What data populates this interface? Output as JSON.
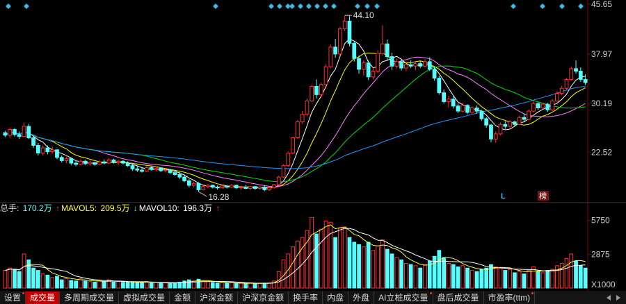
{
  "price_axis": {
    "labels": [
      "45.65",
      "37.97",
      "30.19",
      "22.52"
    ],
    "max": 45.65,
    "min": 15.0
  },
  "annotations": {
    "high": "44.10",
    "low": "16.28",
    "marker_l": "L",
    "marker_bang": "榜"
  },
  "volume_legend": {
    "total_label": "总手:",
    "total_value": "170.2万",
    "mavol5_label": "MAVOL5:",
    "mavol5_value": "209.5万",
    "mavol10_label": "MAVOL10:",
    "mavol10_value": "196.3万",
    "mavol5_arrow": "↑",
    "mavol10_arrow": "↓",
    "total_arrow": "↑"
  },
  "volume_axis": {
    "labels": [
      "5750",
      "2875"
    ],
    "unit": "X1000",
    "max": 6200
  },
  "tabs": [
    {
      "label": "设置",
      "dot": true
    },
    {
      "label": "成交量",
      "active": true
    },
    {
      "label": "多周期成交量"
    },
    {
      "label": "虚拟成交量"
    },
    {
      "label": "金额"
    },
    {
      "label": "沪深金额"
    },
    {
      "label": "沪深京金额"
    },
    {
      "label": "换手率"
    },
    {
      "label": "内盘"
    },
    {
      "label": "外盘"
    },
    {
      "label": "AI立桩成交量",
      "dot": true
    },
    {
      "label": "盘后成交量"
    },
    {
      "label": "市盈率(ttm)",
      "dot": true
    }
  ],
  "colors": {
    "up": "#ff3232",
    "down": "#54ffff",
    "ma1": "#ffffff",
    "ma2": "#ffff00",
    "ma3": "#ff80ff",
    "ma4": "#00e000",
    "ma5": "#1e9aff",
    "grid": "#800000"
  },
  "chart_data": {
    "type": "candlestick",
    "candles": [
      [
        25.6,
        25.9,
        24.9,
        25.2
      ],
      [
        25.2,
        26.4,
        24.8,
        26.1
      ],
      [
        26.1,
        26.3,
        25.0,
        25.3
      ],
      [
        25.3,
        25.8,
        24.6,
        25.0
      ],
      [
        25.0,
        27.2,
        24.9,
        26.6
      ],
      [
        26.6,
        27.0,
        24.6,
        24.8
      ],
      [
        24.8,
        25.0,
        23.2,
        23.6
      ],
      [
        23.6,
        24.0,
        22.0,
        22.4
      ],
      [
        22.4,
        23.6,
        22.0,
        23.2
      ],
      [
        23.2,
        23.6,
        22.2,
        22.6
      ],
      [
        22.6,
        23.4,
        22.3,
        22.9
      ],
      [
        22.9,
        23.0,
        21.4,
        21.7
      ],
      [
        21.7,
        22.0,
        20.9,
        21.2
      ],
      [
        21.2,
        21.8,
        20.8,
        21.5
      ],
      [
        21.5,
        21.6,
        20.5,
        20.8
      ],
      [
        20.8,
        21.2,
        20.3,
        20.6
      ],
      [
        20.6,
        21.4,
        20.4,
        21.1
      ],
      [
        21.1,
        21.3,
        20.5,
        20.7
      ],
      [
        20.7,
        21.2,
        20.4,
        20.9
      ],
      [
        20.9,
        21.0,
        20.4,
        20.6
      ],
      [
        20.6,
        21.3,
        20.5,
        21.0
      ],
      [
        21.0,
        21.4,
        20.6,
        20.8
      ],
      [
        20.8,
        21.6,
        20.7,
        21.3
      ],
      [
        21.3,
        21.5,
        20.7,
        20.9
      ],
      [
        20.9,
        21.3,
        20.5,
        21.1
      ],
      [
        21.1,
        21.3,
        20.6,
        20.8
      ],
      [
        20.8,
        21.1,
        20.2,
        20.4
      ],
      [
        20.4,
        20.6,
        19.6,
        19.9
      ],
      [
        19.9,
        20.4,
        19.4,
        19.7
      ],
      [
        19.7,
        20.2,
        19.3,
        19.5
      ],
      [
        19.5,
        20.4,
        19.4,
        20.1
      ],
      [
        20.1,
        20.3,
        19.6,
        19.8
      ],
      [
        19.8,
        20.3,
        19.5,
        20.0
      ],
      [
        20.0,
        20.1,
        19.4,
        19.6
      ],
      [
        19.6,
        20.0,
        19.3,
        19.7
      ],
      [
        19.7,
        19.9,
        19.1,
        19.3
      ],
      [
        19.3,
        19.6,
        18.8,
        19.0
      ],
      [
        19.0,
        19.4,
        18.3,
        18.6
      ],
      [
        18.6,
        18.9,
        17.8,
        18.0
      ],
      [
        18.0,
        18.3,
        17.0,
        17.3
      ],
      [
        17.3,
        17.9,
        17.0,
        17.6
      ],
      [
        17.6,
        17.8,
        16.3,
        16.6
      ],
      [
        16.6,
        17.3,
        16.5,
        17.1
      ],
      [
        17.1,
        17.5,
        16.8,
        17.3
      ],
      [
        17.3,
        17.4,
        16.8,
        17.0
      ],
      [
        17.0,
        17.3,
        16.6,
        16.9
      ],
      [
        16.9,
        17.4,
        16.8,
        17.2
      ],
      [
        17.2,
        17.3,
        16.8,
        17.0
      ],
      [
        17.0,
        17.5,
        16.9,
        17.3
      ],
      [
        17.3,
        17.4,
        16.7,
        16.9
      ],
      [
        16.9,
        17.2,
        16.6,
        17.0
      ],
      [
        17.0,
        17.3,
        16.7,
        16.8
      ],
      [
        16.8,
        17.2,
        16.6,
        17.1
      ],
      [
        17.1,
        17.2,
        16.6,
        16.8
      ],
      [
        16.8,
        17.2,
        16.6,
        17.0
      ],
      [
        17.0,
        17.2,
        16.4,
        16.6
      ],
      [
        16.6,
        17.0,
        16.4,
        16.9
      ],
      [
        16.9,
        17.5,
        16.8,
        17.4
      ],
      [
        17.4,
        18.8,
        17.3,
        18.6
      ],
      [
        18.6,
        20.6,
        18.5,
        20.4
      ],
      [
        20.4,
        22.6,
        20.2,
        22.4
      ],
      [
        22.4,
        25.0,
        22.2,
        24.8
      ],
      [
        24.8,
        27.6,
        24.6,
        27.3
      ],
      [
        27.3,
        29.0,
        27.0,
        28.5
      ],
      [
        28.5,
        31.0,
        28.2,
        30.6
      ],
      [
        30.6,
        33.2,
        30.4,
        32.9
      ],
      [
        32.9,
        34.0,
        31.0,
        31.6
      ],
      [
        31.6,
        33.5,
        31.3,
        33.2
      ],
      [
        33.2,
        36.4,
        33.0,
        36.0
      ],
      [
        36.0,
        39.5,
        35.8,
        39.1
      ],
      [
        39.1,
        40.4,
        37.4,
        38.0
      ],
      [
        38.0,
        42.3,
        37.8,
        42.0
      ],
      [
        42.0,
        44.1,
        41.6,
        43.2
      ],
      [
        43.2,
        44.0,
        39.2,
        39.7
      ],
      [
        39.7,
        40.0,
        36.8,
        37.3
      ],
      [
        37.3,
        37.8,
        34.9,
        35.6
      ],
      [
        35.6,
        37.0,
        34.6,
        36.6
      ],
      [
        36.6,
        37.0,
        33.9,
        34.4
      ],
      [
        34.4,
        35.8,
        34.0,
        35.3
      ],
      [
        35.3,
        38.6,
        35.0,
        38.1
      ],
      [
        38.1,
        42.5,
        37.8,
        39.6
      ],
      [
        39.6,
        40.3,
        37.1,
        37.6
      ],
      [
        37.6,
        38.2,
        35.5,
        36.1
      ],
      [
        36.1,
        37.3,
        35.7,
        36.8
      ],
      [
        36.8,
        37.1,
        35.4,
        35.8
      ],
      [
        35.8,
        36.7,
        35.3,
        36.3
      ],
      [
        36.3,
        37.0,
        35.8,
        36.1
      ],
      [
        36.1,
        36.9,
        35.5,
        36.5
      ],
      [
        36.5,
        37.0,
        35.8,
        36.1
      ],
      [
        36.1,
        37.2,
        35.9,
        36.8
      ],
      [
        36.8,
        37.5,
        35.3,
        35.6
      ],
      [
        35.6,
        36.0,
        33.8,
        34.2
      ],
      [
        34.2,
        34.6,
        31.6,
        31.9
      ],
      [
        31.9,
        32.4,
        30.2,
        30.5
      ],
      [
        30.5,
        31.4,
        29.6,
        30.9
      ],
      [
        30.9,
        31.3,
        29.4,
        29.8
      ],
      [
        29.8,
        30.2,
        28.7,
        29.0
      ],
      [
        29.0,
        30.3,
        28.8,
        29.9
      ],
      [
        29.9,
        30.1,
        28.5,
        28.8
      ],
      [
        28.8,
        29.8,
        28.6,
        29.5
      ],
      [
        29.5,
        29.9,
        28.6,
        29.0
      ],
      [
        29.0,
        29.2,
        27.5,
        27.8
      ],
      [
        27.8,
        28.1,
        26.4,
        26.8
      ],
      [
        26.8,
        27.0,
        24.1,
        24.6
      ],
      [
        24.6,
        25.8,
        24.0,
        25.4
      ],
      [
        25.4,
        27.2,
        25.2,
        26.9
      ],
      [
        26.9,
        27.4,
        26.2,
        26.6
      ],
      [
        26.6,
        27.6,
        26.4,
        27.3
      ],
      [
        27.3,
        27.5,
        26.6,
        26.9
      ],
      [
        26.9,
        28.3,
        26.8,
        28.0
      ],
      [
        28.0,
        28.6,
        27.4,
        27.7
      ],
      [
        27.7,
        29.3,
        27.5,
        29.0
      ],
      [
        29.0,
        30.6,
        28.8,
        30.2
      ],
      [
        30.2,
        30.4,
        29.2,
        29.5
      ],
      [
        29.5,
        30.3,
        29.3,
        30.1
      ],
      [
        30.1,
        30.3,
        28.9,
        29.2
      ],
      [
        29.2,
        30.9,
        29.0,
        30.6
      ],
      [
        30.6,
        32.1,
        30.4,
        31.8
      ],
      [
        31.8,
        33.0,
        31.5,
        32.6
      ],
      [
        32.6,
        34.2,
        32.4,
        34.0
      ],
      [
        34.0,
        36.0,
        33.8,
        35.7
      ],
      [
        35.7,
        37.0,
        34.9,
        35.3
      ],
      [
        35.3,
        35.9,
        33.6,
        34.0
      ],
      [
        34.0,
        34.8,
        33.1,
        33.5
      ]
    ],
    "volumes": [
      [
        1500,
        1
      ],
      [
        1700,
        1
      ],
      [
        1600,
        0
      ],
      [
        1400,
        0
      ],
      [
        2900,
        1
      ],
      [
        2400,
        0
      ],
      [
        1700,
        0
      ],
      [
        1500,
        0
      ],
      [
        1200,
        1
      ],
      [
        1100,
        0
      ],
      [
        900,
        1
      ],
      [
        1000,
        0
      ],
      [
        700,
        0
      ],
      [
        800,
        1
      ],
      [
        650,
        0
      ],
      [
        600,
        0
      ],
      [
        800,
        1
      ],
      [
        600,
        0
      ],
      [
        550,
        1
      ],
      [
        500,
        0
      ],
      [
        600,
        1
      ],
      [
        550,
        0
      ],
      [
        700,
        1
      ],
      [
        500,
        0
      ],
      [
        550,
        1
      ],
      [
        480,
        0
      ],
      [
        500,
        0
      ],
      [
        520,
        0
      ],
      [
        500,
        0
      ],
      [
        450,
        0
      ],
      [
        560,
        1
      ],
      [
        420,
        0
      ],
      [
        480,
        1
      ],
      [
        400,
        0
      ],
      [
        430,
        1
      ],
      [
        420,
        0
      ],
      [
        450,
        0
      ],
      [
        500,
        0
      ],
      [
        600,
        0
      ],
      [
        700,
        0
      ],
      [
        600,
        1
      ],
      [
        750,
        0
      ],
      [
        560,
        1
      ],
      [
        540,
        1
      ],
      [
        480,
        0
      ],
      [
        430,
        0
      ],
      [
        470,
        1
      ],
      [
        420,
        0
      ],
      [
        440,
        1
      ],
      [
        400,
        0
      ],
      [
        400,
        1
      ],
      [
        380,
        0
      ],
      [
        420,
        1
      ],
      [
        370,
        0
      ],
      [
        400,
        1
      ],
      [
        420,
        0
      ],
      [
        440,
        1
      ],
      [
        600,
        1
      ],
      [
        1400,
        1
      ],
      [
        2400,
        1
      ],
      [
        2900,
        1
      ],
      [
        3500,
        1
      ],
      [
        4000,
        1
      ],
      [
        4300,
        1
      ],
      [
        4900,
        1
      ],
      [
        6000,
        1
      ],
      [
        4600,
        0
      ],
      [
        5000,
        1
      ],
      [
        5700,
        1
      ],
      [
        5600,
        1
      ],
      [
        4300,
        0
      ],
      [
        5100,
        1
      ],
      [
        5200,
        1
      ],
      [
        4300,
        0
      ],
      [
        3900,
        0
      ],
      [
        3700,
        0
      ],
      [
        3500,
        1
      ],
      [
        3900,
        0
      ],
      [
        3200,
        1
      ],
      [
        3600,
        1
      ],
      [
        4100,
        1
      ],
      [
        3300,
        0
      ],
      [
        2900,
        0
      ],
      [
        2600,
        1
      ],
      [
        2400,
        0
      ],
      [
        2100,
        1
      ],
      [
        2000,
        0
      ],
      [
        1900,
        1
      ],
      [
        1700,
        0
      ],
      [
        2000,
        1
      ],
      [
        2300,
        0
      ],
      [
        2700,
        0
      ],
      [
        3200,
        0
      ],
      [
        2600,
        0
      ],
      [
        2100,
        1
      ],
      [
        2000,
        0
      ],
      [
        1800,
        0
      ],
      [
        1900,
        1
      ],
      [
        1700,
        0
      ],
      [
        1500,
        1
      ],
      [
        1400,
        0
      ],
      [
        1600,
        0
      ],
      [
        1700,
        0
      ],
      [
        2000,
        0
      ],
      [
        1800,
        1
      ],
      [
        1700,
        1
      ],
      [
        1500,
        0
      ],
      [
        1600,
        1
      ],
      [
        1300,
        0
      ],
      [
        1400,
        1
      ],
      [
        1200,
        0
      ],
      [
        1500,
        1
      ],
      [
        1800,
        1
      ],
      [
        1400,
        0
      ],
      [
        1300,
        1
      ],
      [
        1500,
        0
      ],
      [
        1600,
        1
      ],
      [
        1900,
        1
      ],
      [
        2100,
        1
      ],
      [
        2500,
        1
      ],
      [
        2900,
        1
      ],
      [
        2300,
        0
      ],
      [
        1900,
        0
      ],
      [
        1700,
        0
      ]
    ]
  }
}
